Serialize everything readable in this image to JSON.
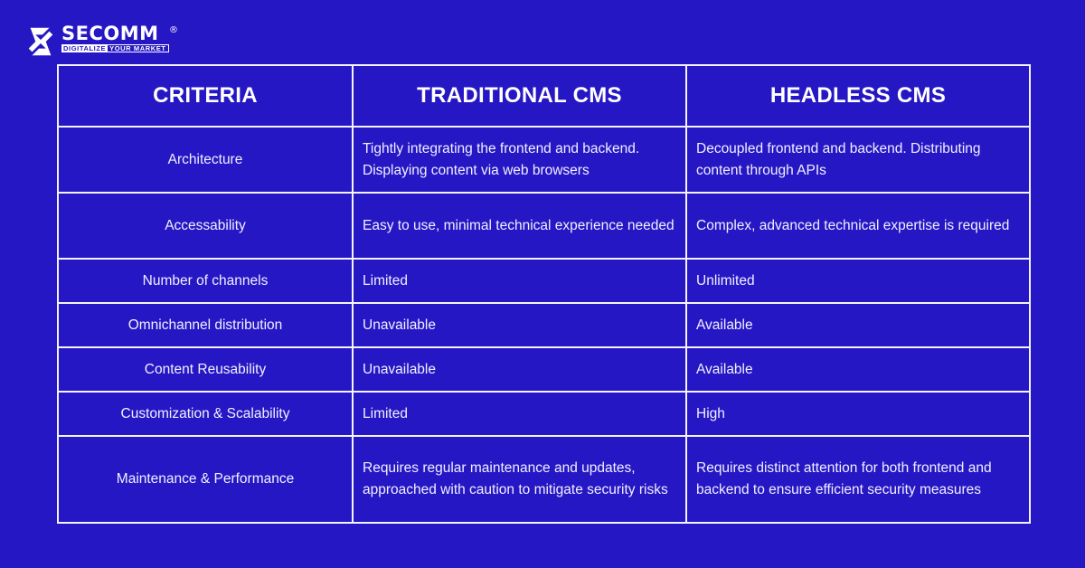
{
  "brand": {
    "name": "SECOMM",
    "registered": "®",
    "tagline_part1": "DIGITALIZE",
    "tagline_part2": "YOUR MARKET",
    "icon": "secomm-s-logo-icon",
    "colors": {
      "background": "#2617c4",
      "text": "#ffffff",
      "border": "#f4f3ff"
    }
  },
  "table": {
    "headers": [
      "CRITERIA",
      "TRADITIONAL CMS",
      "HEADLESS CMS"
    ],
    "rows": [
      {
        "criteria": "Architecture",
        "traditional": "Tightly integrating the frontend and backend. Displaying content via web browsers",
        "headless": "Decoupled frontend and backend. Distributing content through APIs"
      },
      {
        "criteria": "Accessability",
        "traditional": "Easy to use, minimal technical experience needed",
        "headless": "Complex, advanced technical expertise is required"
      },
      {
        "criteria": "Number of channels",
        "traditional": "Limited",
        "headless": "Unlimited"
      },
      {
        "criteria": "Omnichannel distribution",
        "traditional": "Unavailable",
        "headless": "Available"
      },
      {
        "criteria": "Content Reusability",
        "traditional": "Unavailable",
        "headless": "Available"
      },
      {
        "criteria": "Customization & Scalability",
        "traditional": "Limited",
        "headless": "High"
      },
      {
        "criteria": "Maintenance & Performance",
        "traditional": "Requires regular maintenance and updates, approached with caution to mitigate security risks",
        "headless": "Requires distinct attention for both frontend and backend to ensure efficient security measures"
      }
    ]
  }
}
